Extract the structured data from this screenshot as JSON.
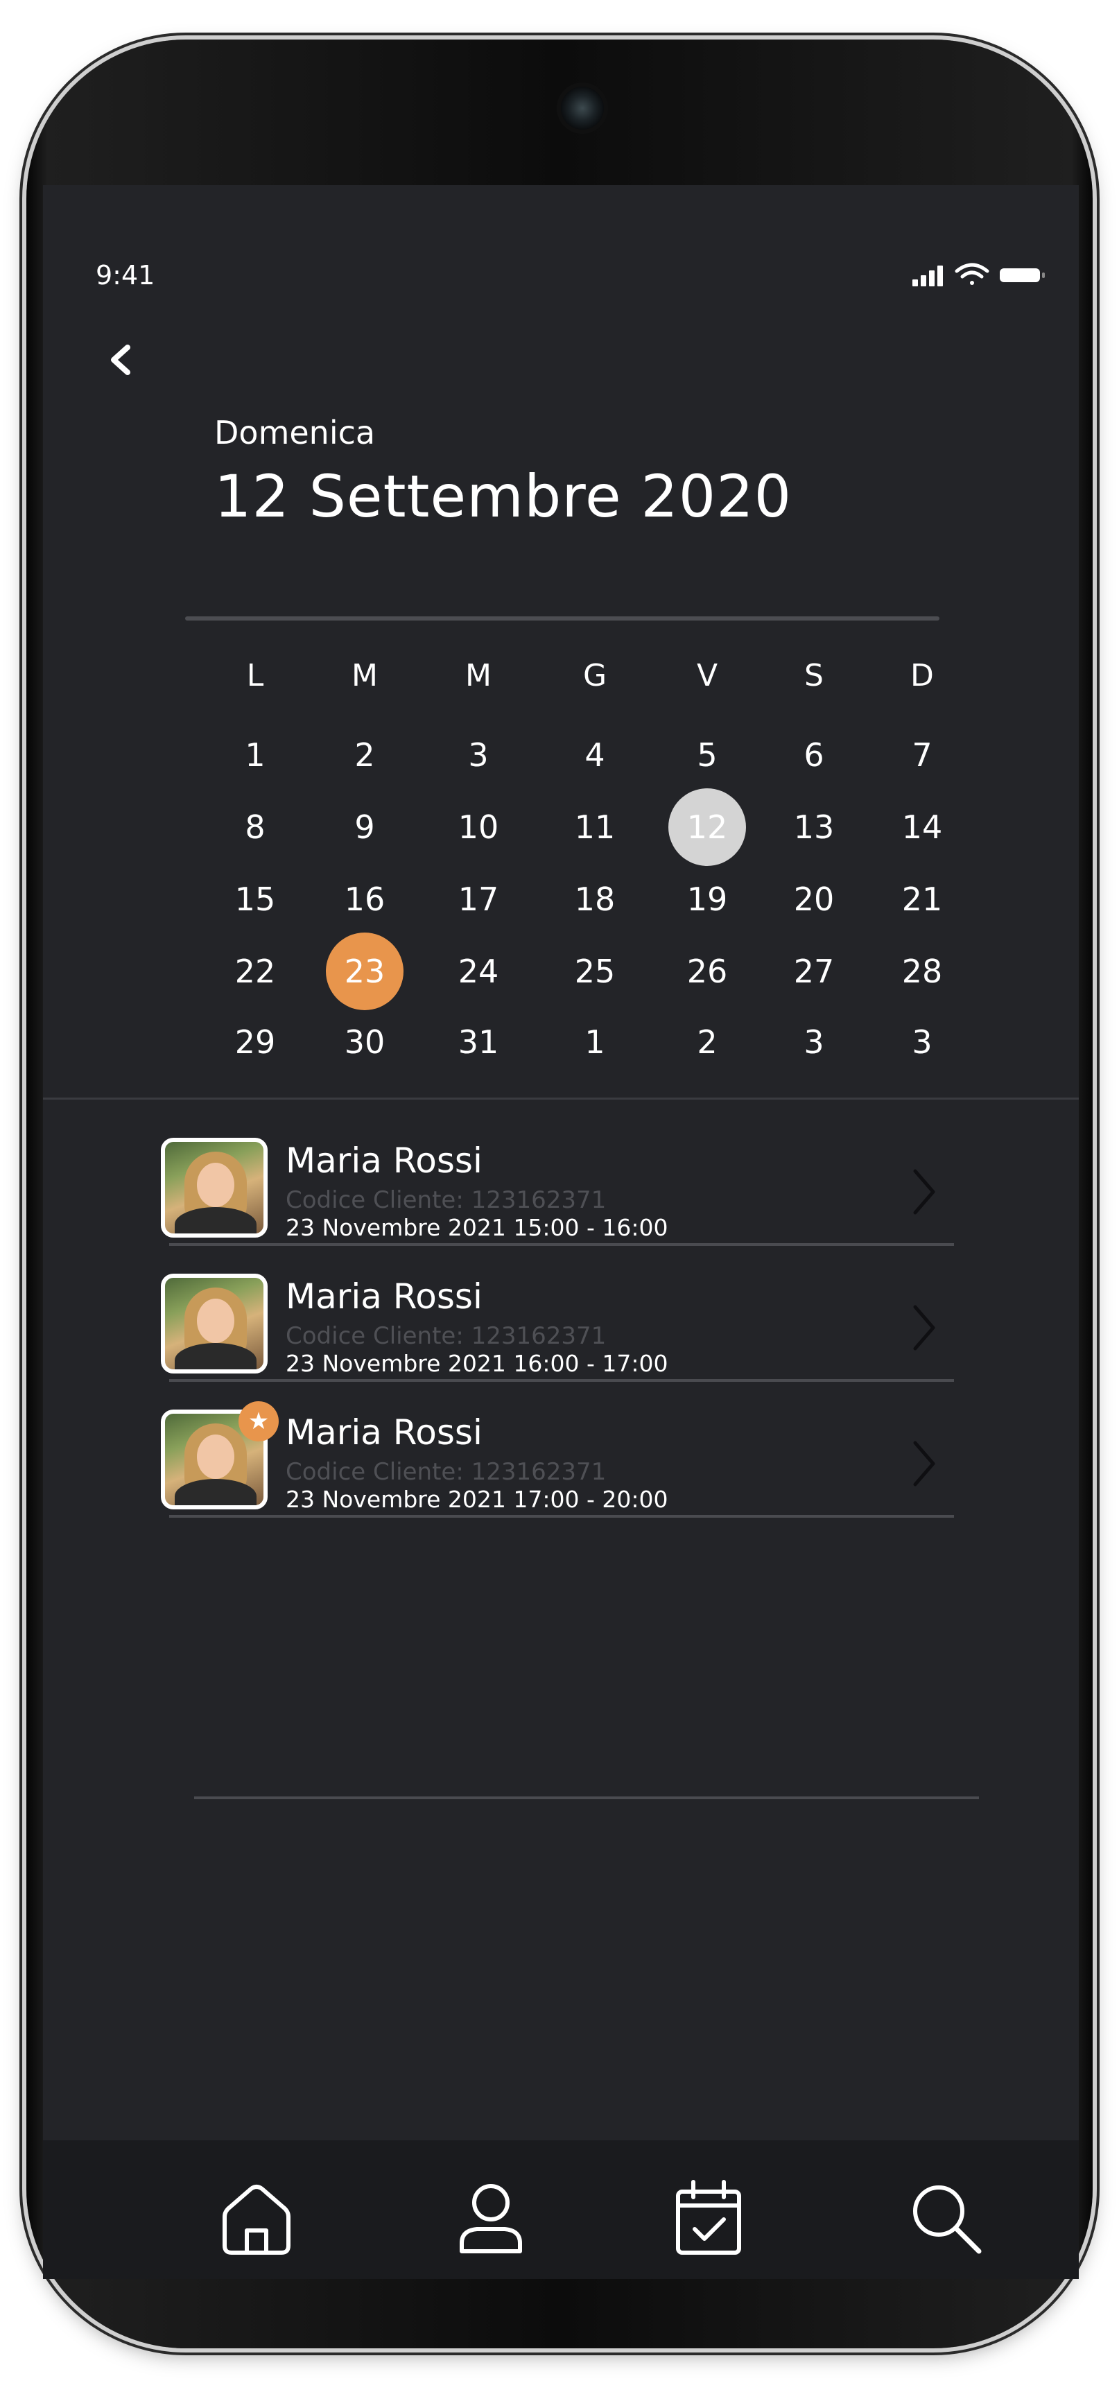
{
  "status_bar": {
    "time": "9:41"
  },
  "header": {
    "day_name": "Domenica",
    "date": "12 Settembre 2020"
  },
  "calendar": {
    "weekdays": [
      "L",
      "M",
      "M",
      "G",
      "V",
      "S",
      "D"
    ],
    "weeks": [
      [
        "1",
        "2",
        "3",
        "4",
        "5",
        "6",
        "7"
      ],
      [
        "8",
        "9",
        "10",
        "11",
        "12",
        "13",
        "14"
      ],
      [
        "15",
        "16",
        "17",
        "18",
        "19",
        "20",
        "21"
      ],
      [
        "22",
        "23",
        "24",
        "25",
        "26",
        "27",
        "28"
      ],
      [
        "29",
        "30",
        "31",
        "1",
        "2",
        "3",
        "3"
      ]
    ],
    "selected_day": "12",
    "today_day": "23",
    "colors": {
      "selected": "#d4d4d4",
      "today": "#e8954c"
    }
  },
  "appointments": [
    {
      "name": "Maria Rossi",
      "code": "Codice Cliente: 123162371",
      "time": "23 Novembre 2021 15:00 - 16:00",
      "starred": false
    },
    {
      "name": "Maria Rossi",
      "code": "Codice Cliente: 123162371",
      "time": "23 Novembre 2021 16:00 - 17:00",
      "starred": false
    },
    {
      "name": "Maria Rossi",
      "code": "Codice Cliente: 123162371",
      "time": "23 Novembre 2021 17:00 - 20:00",
      "starred": true
    }
  ],
  "nav": {
    "items": [
      {
        "icon": "home-icon"
      },
      {
        "icon": "user-icon"
      },
      {
        "icon": "calendar-check-icon"
      },
      {
        "icon": "search-icon"
      }
    ]
  },
  "theme": {
    "background": "#232428",
    "accent": "#e8954c",
    "nav_background": "#1a1b1e"
  }
}
